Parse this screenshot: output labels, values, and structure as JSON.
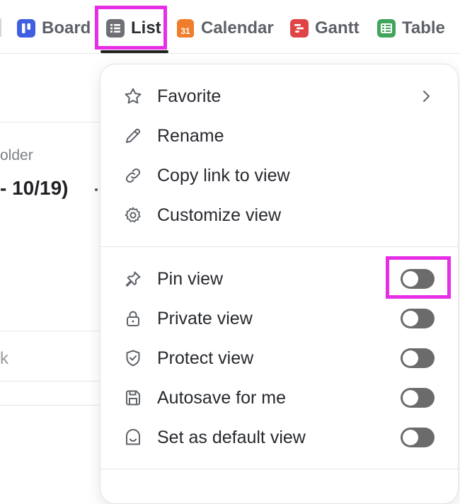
{
  "viewbar": {
    "tabs": [
      {
        "label": "Board",
        "icon": "board-icon",
        "color": "#3f5fe0"
      },
      {
        "label": "List",
        "icon": "list-icon",
        "color": "#6e7076"
      },
      {
        "label": "Calendar",
        "icon": "calendar-icon",
        "color": "#ef7d2c",
        "icon_text": "31"
      },
      {
        "label": "Gantt",
        "icon": "gantt-icon",
        "color": "#e04444"
      },
      {
        "label": "Table",
        "icon": "table-icon",
        "color": "#3fa55a"
      }
    ],
    "active_tab": "List"
  },
  "background": {
    "folder_text": "older",
    "date_text": "- 10/19)",
    "fragment_text": "k"
  },
  "menu": {
    "actions": [
      {
        "label": "Favorite",
        "icon": "star-icon",
        "has_submenu": true
      },
      {
        "label": "Rename",
        "icon": "pencil-icon"
      },
      {
        "label": "Copy link to view",
        "icon": "link-icon"
      },
      {
        "label": "Customize view",
        "icon": "gear-icon"
      }
    ],
    "toggles": [
      {
        "label": "Pin view",
        "icon": "pin-icon",
        "on": false
      },
      {
        "label": "Private view",
        "icon": "lock-icon",
        "on": false
      },
      {
        "label": "Protect view",
        "icon": "shield-icon",
        "on": false
      },
      {
        "label": "Autosave for me",
        "icon": "save-icon",
        "on": false
      },
      {
        "label": "Set as default view",
        "icon": "default-view-icon",
        "on": false
      }
    ]
  },
  "colors": {
    "highlight": "#e62ee6",
    "toggle_off": "#6b6b6b"
  }
}
